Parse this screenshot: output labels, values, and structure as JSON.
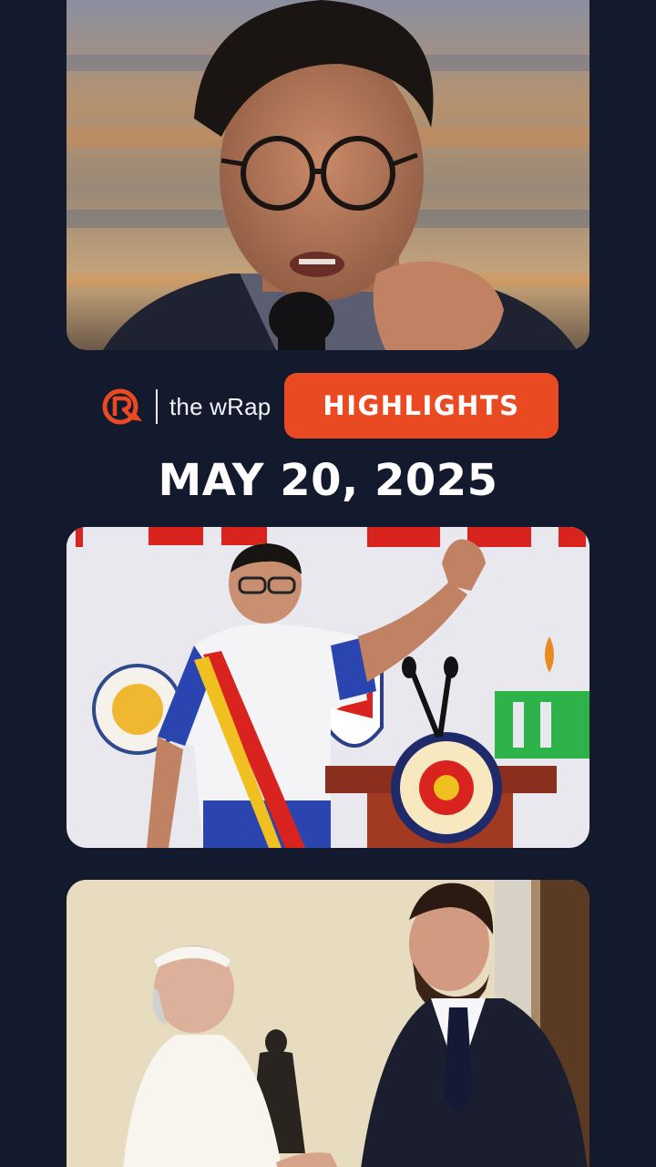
{
  "header": {
    "brand_logo": "rappler-logo",
    "show_name": "the wRap",
    "badge_label": "HIGHLIGHTS",
    "date": "MAY 20, 2025"
  },
  "photos": [
    {
      "name": "photo-speaker-with-glasses"
    },
    {
      "name": "photo-president-waving-at-podium"
    },
    {
      "name": "photo-pope-handshake"
    }
  ],
  "colors": {
    "background": "#141a2e",
    "accent": "#ea4a22",
    "text": "#ffffff"
  }
}
